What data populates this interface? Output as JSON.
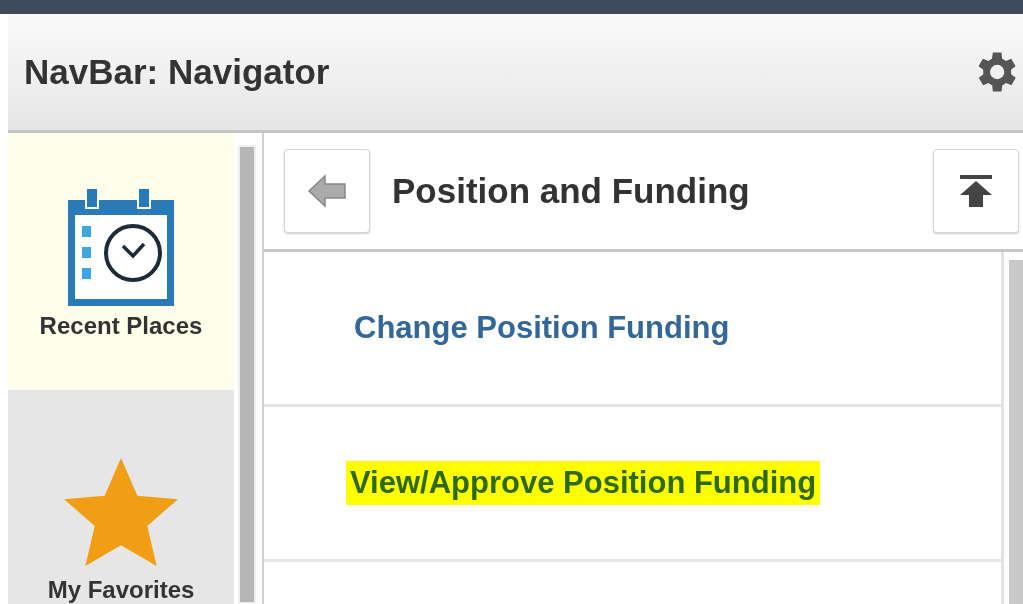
{
  "navbar": {
    "title": "NavBar: Navigator"
  },
  "sidebar": {
    "items": [
      {
        "label": "Recent Places",
        "kind": "recent",
        "selected": true
      },
      {
        "label": "My Favorites",
        "kind": "favorites",
        "selected": false
      }
    ]
  },
  "panel": {
    "title": "Position and Funding",
    "links": [
      {
        "label": "Change Position Funding",
        "highlighted": false
      },
      {
        "label": "View/Approve Position Funding",
        "highlighted": true
      }
    ]
  }
}
